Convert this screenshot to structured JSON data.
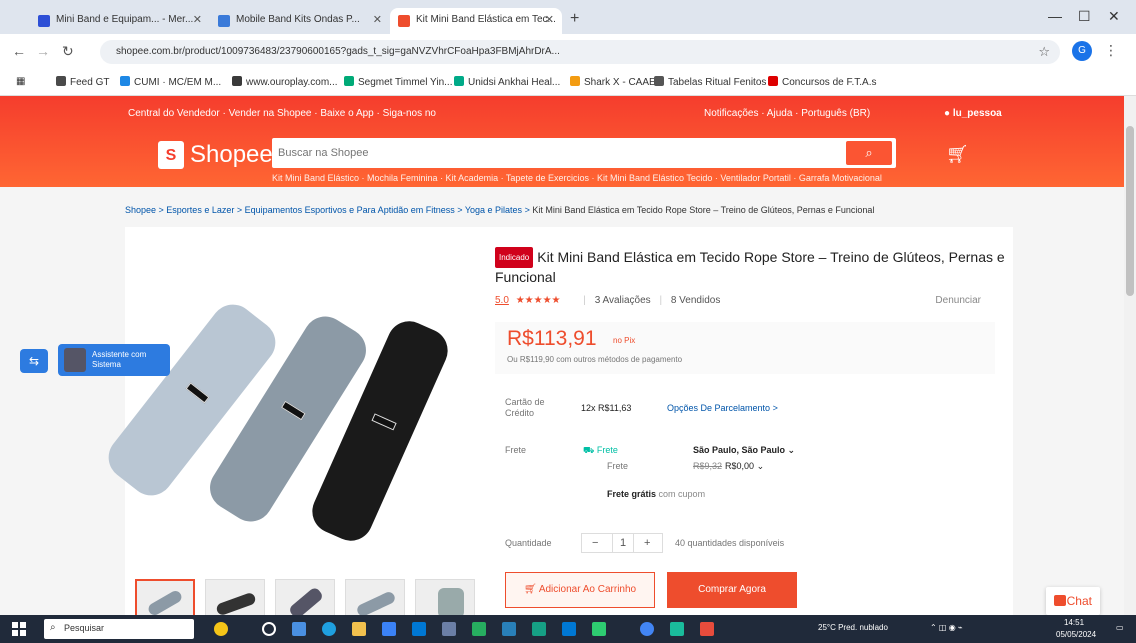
{
  "browser": {
    "tabs": [
      {
        "title": "Mini Band e Equipam... - Mer...",
        "active": false,
        "favicon_color": "#2d4fd6"
      },
      {
        "title": "Mobile Band Kits Ondas P...",
        "active": false,
        "favicon_color": "#3a7ad9"
      },
      {
        "title": "Kit Mini Band Elástica em Tec...",
        "active": true,
        "favicon_color": "#ee4d2d"
      }
    ],
    "new_tab": "+",
    "window_controls": [
      "—",
      "☐",
      "✕"
    ],
    "url": "shopee.com.br/product/1009736483/23790600165?gads_t_sig=gaNVZVhrCFoaHpa3FBMjAhrDrA...",
    "profile_initial": "G",
    "bookmarks": [
      {
        "label": "Feed GT",
        "color": "#4a4a4a"
      },
      {
        "label": "CUMI · MC/EM M...",
        "color": "#1e88e5"
      },
      {
        "label": "www.ouroplay.com...",
        "color": "#3a3a3a"
      },
      {
        "label": "Segmet Timmel Yin...",
        "color": "#0a7"
      },
      {
        "label": "Unidsi Ankhai Heal...",
        "color": "#0a8"
      },
      {
        "label": "Shark X - CAAE",
        "color": "#f39c12"
      },
      {
        "label": "Tabelas Ritual Fenitos",
        "color": "#555"
      },
      {
        "label": "Concursos de F.T.A.s",
        "color": "#d00"
      }
    ]
  },
  "shopee": {
    "topnav_left": "Central do Vendedor · Vender na Shopee · Baixe o App · Siga-nos no",
    "topnav_right": "Notificações · Ajuda · Português (BR)",
    "user": "lu_pessoa",
    "logo": "Shopee",
    "search_placeholder": "Buscar na Shopee",
    "search_suggestions": "Kit Mini Band Elástico · Mochila Feminina · Kit Academia · Tapete de Exercicios · Kit Mini Band Elástico Tecido · Ventilador Portatil · Garrafa Motivacional",
    "breadcrumb": [
      "Shopee",
      "Esportes e Lazer",
      "Equipamentos Esportivos e Para Aptidão em Fitness",
      "Yoga e Pilates",
      "Kit Mini Band Elástica em Tecido Rope Store – Treino de Glúteos, Pernas e Funcional"
    ]
  },
  "product": {
    "badge": "Indicado",
    "title": "Kit Mini Band Elástica em Tecido Rope Store – Treino de Glúteos, Pernas e Funcional",
    "rating": "5.0",
    "stars": "★★★★★",
    "reviews": "3 Avaliações",
    "sold": "8 Vendidos",
    "report": "Denunciar",
    "price": "R$113,91",
    "price_note": "no Pix",
    "price_sub": "Ou R$119,90 com outros métodos de pagamento",
    "card_label": "Cartão de Crédito",
    "installments": "12x R$11,63",
    "installments_link": "Opções De Parcelamento",
    "shipping_label": "Frete",
    "shipping_free_badge": "Frete",
    "shipping_to_label": "Frete",
    "location": "São Paulo, São Paulo",
    "shipping_cost_old": "R$9,32",
    "shipping_cost": "R$0,00",
    "free_shipping": "Frete grátis",
    "free_shipping_note": "com cupom",
    "quantity_label": "Quantidade",
    "quantity": "1",
    "stock": "40 quantidades disponíveis",
    "add_to_cart": "Adicionar Ao Carrinho",
    "buy_now": "Comprar Agora"
  },
  "widgets": {
    "side_icon": "⇆",
    "side_chip_line1": "Assistente com",
    "side_chip_line2": "Sistema",
    "chat": "Chat"
  },
  "taskbar": {
    "search": "Pesquisar",
    "weather": "25°C Pred. nublado",
    "time": "14:51",
    "date": "05/05/2024"
  },
  "colors": {
    "brand": "#ee4d2d",
    "band_light": "#b9c6d3",
    "band_mid": "#8c9aa6",
    "band_dark": "#1a1a1a"
  }
}
